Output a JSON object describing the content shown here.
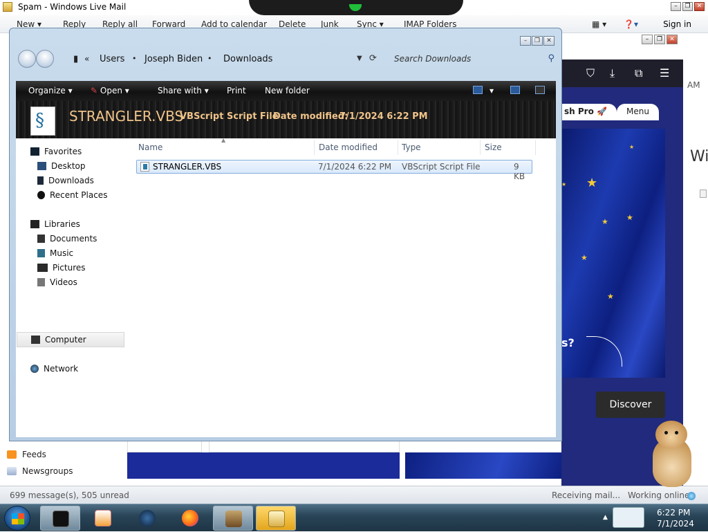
{
  "wlm": {
    "title": "Spam - Windows Live Mail",
    "toolbar": [
      "New",
      "Reply",
      "Reply all",
      "Forward",
      "Add to calendar",
      "Delete",
      "Junk",
      "Sync",
      "IMAP Folders"
    ],
    "sign_in": "Sign in",
    "folders": [
      "Feeds",
      "Newsgroups"
    ],
    "status": {
      "messages": "699 message(s), 505 unread",
      "receiving": "Receiving mail...",
      "online": "Working online"
    }
  },
  "firefox": {
    "side_text_am": "AM",
    "side_text_wi": "Wi",
    "pill_pro": "sh Pro 🚀",
    "pill_menu": "Menu",
    "question": "s?",
    "discover": "Discover"
  },
  "explorer": {
    "breadcrumb": [
      "Users",
      "Joseph Biden",
      "Downloads"
    ],
    "search_placeholder": "Search Downloads",
    "commands": {
      "organize": "Organize",
      "open": "Open",
      "share_with": "Share with",
      "print": "Print",
      "new_folder": "New folder"
    },
    "preview": {
      "name": "STRANGLER.VBS",
      "type": "VBScript Script File",
      "date_label": "Date modified:",
      "date": "7/1/2024 6:22 PM"
    },
    "nav": {
      "favorites": "Favorites",
      "desktop": "Desktop",
      "downloads": "Downloads",
      "recent": "Recent Places",
      "libraries": "Libraries",
      "documents": "Documents",
      "music": "Music",
      "pictures": "Pictures",
      "videos": "Videos",
      "computer": "Computer",
      "network": "Network"
    },
    "columns": [
      "Name",
      "Date modified",
      "Type",
      "Size"
    ],
    "files": [
      {
        "name": "STRANGLER.VBS",
        "date": "7/1/2024 6:22 PM",
        "type": "VBScript Script File",
        "size": "9 KB"
      }
    ]
  },
  "taskbar": {
    "time": "6:22 PM",
    "date": "7/1/2024"
  }
}
